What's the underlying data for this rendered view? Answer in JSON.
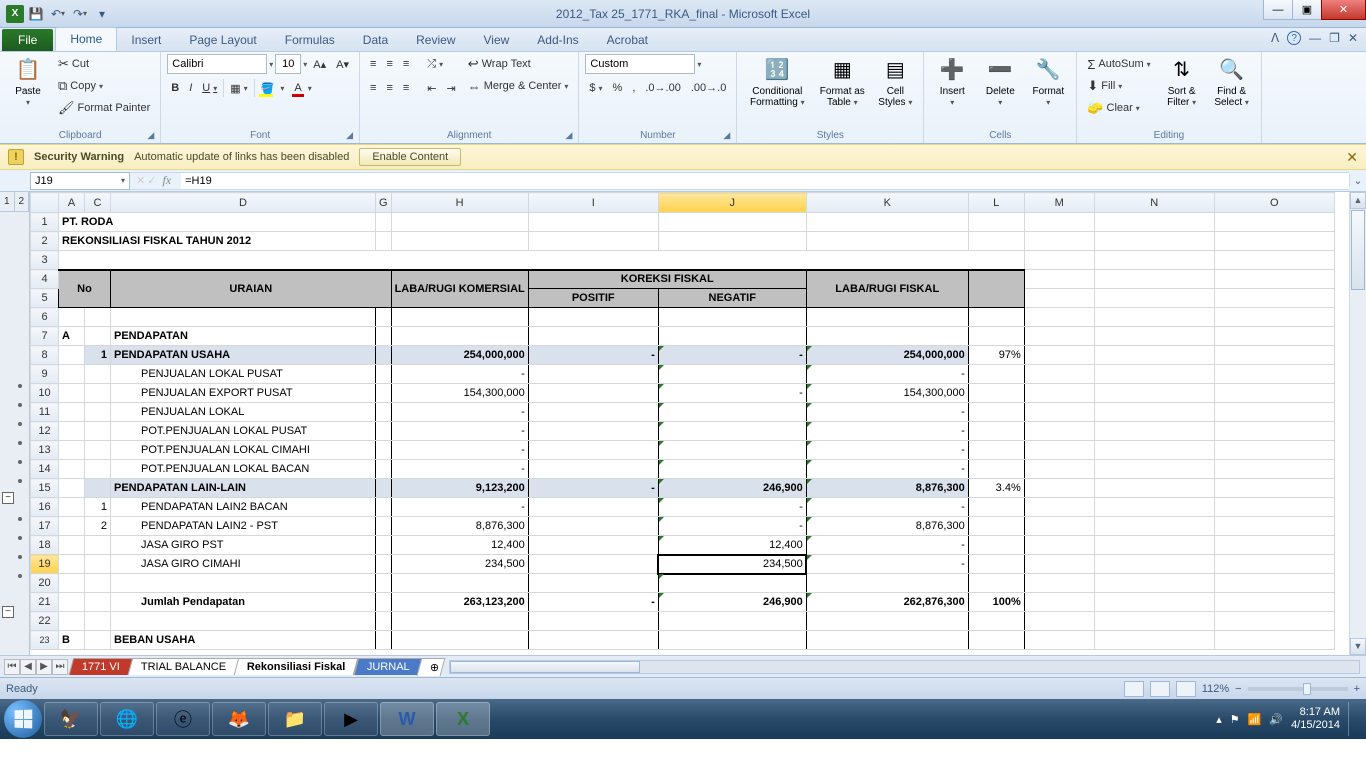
{
  "title": "2012_Tax 25_1771_RKA_final - Microsoft Excel",
  "tabs": {
    "file": "File",
    "home": "Home",
    "insert": "Insert",
    "pagelayout": "Page Layout",
    "formulas": "Formulas",
    "data": "Data",
    "review": "Review",
    "view": "View",
    "addins": "Add-Ins",
    "acrobat": "Acrobat"
  },
  "clipboard": {
    "paste": "Paste",
    "cut": "Cut",
    "copy": "Copy",
    "fp": "Format Painter",
    "label": "Clipboard"
  },
  "font": {
    "name": "Calibri",
    "size": "10",
    "label": "Font"
  },
  "alignment": {
    "wrap": "Wrap Text",
    "merge": "Merge & Center",
    "label": "Alignment"
  },
  "number": {
    "format": "Custom",
    "label": "Number"
  },
  "styles": {
    "cond": "Conditional Formatting",
    "fmt": "Format as Table",
    "cell": "Cell Styles",
    "label": "Styles"
  },
  "cells": {
    "insert": "Insert",
    "delete": "Delete",
    "format": "Format",
    "label": "Cells"
  },
  "editing": {
    "sum": "AutoSum",
    "fill": "Fill",
    "clear": "Clear",
    "sort": "Sort & Filter",
    "find": "Find & Select",
    "label": "Editing"
  },
  "security": {
    "title": "Security Warning",
    "msg": "Automatic update of links has been disabled",
    "btn": "Enable Content"
  },
  "namebox": "J19",
  "formula": "=H19",
  "cols": [
    "A",
    "C",
    "D",
    "G",
    "H",
    "I",
    "J",
    "K",
    "L",
    "M",
    "N",
    "O"
  ],
  "rows": {
    "1": {
      "d": "PT. RODA"
    },
    "2": {
      "d": "REKONSILIASI FISKAL TAHUN 2012"
    },
    "hdr": {
      "no": "No",
      "uraian": "URAIAN",
      "labarugi": "LABA/RUGI KOMERSIAL",
      "koreksi": "KOREKSI FISKAL",
      "positif": "POSITIF",
      "negatif": "NEGATIF",
      "fiskal": "LABA/RUGI FISKAL"
    },
    "7": {
      "a": "A",
      "d": "PENDAPATAN"
    },
    "8": {
      "c": "1",
      "d": "PENDAPATAN USAHA",
      "h": "254,000,000",
      "i": "-",
      "j": "-",
      "k": "254,000,000",
      "l": "97%"
    },
    "9": {
      "d": "PENJUALAN LOKAL PUSAT",
      "h": "-",
      "k": "-"
    },
    "10": {
      "d": "PENJUALAN EXPORT PUSAT",
      "h": "154,300,000",
      "j": "-",
      "k": "154,300,000"
    },
    "11": {
      "d": "PENJUALAN LOKAL",
      "h": "-",
      "k": "-"
    },
    "12": {
      "d": "POT.PENJUALAN LOKAL PUSAT",
      "h": "-",
      "k": "-"
    },
    "13": {
      "d": "POT.PENJUALAN LOKAL CIMAHI",
      "h": "-",
      "k": "-"
    },
    "14": {
      "d": "POT.PENJUALAN LOKAL BACAN",
      "h": "-",
      "k": "-"
    },
    "15": {
      "d": "PENDAPATAN LAIN-LAIN",
      "h": "9,123,200",
      "i": "-",
      "j": "246,900",
      "k": "8,876,300",
      "l": "3.4%"
    },
    "16": {
      "c": "1",
      "d": "PENDAPATAN LAIN2 BACAN",
      "h": "-",
      "j": "-",
      "k": "-"
    },
    "17": {
      "c": "2",
      "d": "PENDAPATAN LAIN2 - PST",
      "h": "8,876,300",
      "j": "-",
      "k": "8,876,300"
    },
    "18": {
      "d": "JASA GIRO PST",
      "h": "12,400",
      "j": "12,400",
      "k": "-"
    },
    "19": {
      "d": "JASA GIRO CIMAHI",
      "h": "234,500",
      "j": "234,500",
      "k": "-"
    },
    "21": {
      "d": "Jumlah Pendapatan",
      "h": "263,123,200",
      "i": "-",
      "j": "246,900",
      "k": "262,876,300",
      "l": "100%"
    },
    "23": {
      "a": "B",
      "d": "BEBAN USAHA"
    }
  },
  "sheets": {
    "s1": "1771 VI",
    "s2": "TRIAL BALANCE",
    "s3": "Rekonsiliasi Fiskal",
    "s4": "JURNAL"
  },
  "status": {
    "ready": "Ready",
    "zoom": "112%"
  },
  "tray": {
    "time": "8:17 AM",
    "date": "4/15/2014"
  }
}
